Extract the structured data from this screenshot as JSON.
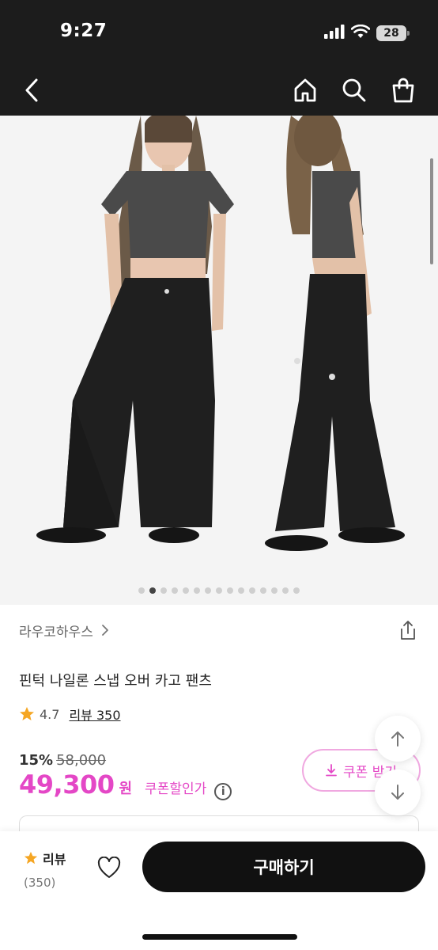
{
  "status_bar": {
    "time": "9:27",
    "battery": "28",
    "icons": [
      "signal-icon",
      "wifi-icon",
      "battery-icon"
    ]
  },
  "nav": {
    "icons": [
      "back-icon",
      "home-icon",
      "search-icon",
      "shopping-bag-icon"
    ]
  },
  "carousel": {
    "total_images": 15,
    "active_index": 1
  },
  "product": {
    "brand": "라우코하우스",
    "title": "핀턱 나일론 스냅 오버 카고 팬츠",
    "rating": "4.7",
    "review_label": "리뷰 350",
    "discount_percent": "15%",
    "original_price": "58,000",
    "price": "49,300",
    "currency": "원",
    "coupon_discount_label": "쿠폰할인가",
    "coupon_button_label": "쿠폰 받기"
  },
  "bottom_bar": {
    "review_label": "리뷰",
    "review_count": "(350)",
    "buy_label": "구매하기"
  },
  "colors": {
    "accent": "#e447c6",
    "dark": "#111111",
    "star": "#f5a623"
  }
}
